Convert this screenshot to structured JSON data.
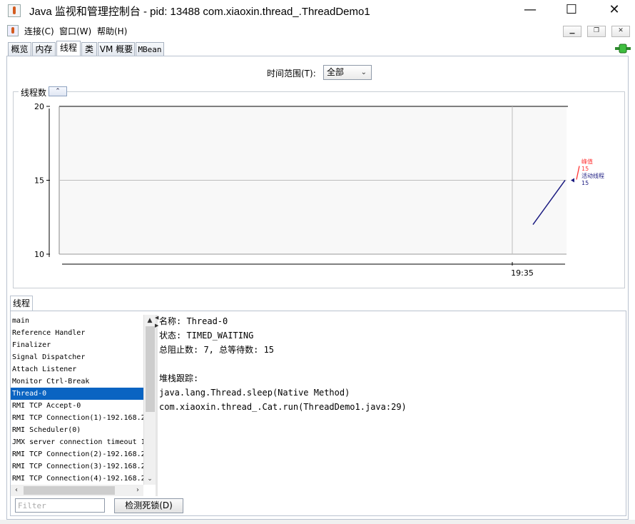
{
  "window": {
    "title": "Java 监视和管理控制台 - pid: 13488 com.xiaoxin.thread_.ThreadDemo1",
    "minimize_glyph": "—",
    "maximize_glyph": "☐",
    "close_glyph": "✕"
  },
  "menubar": {
    "items": [
      "连接(C)",
      "窗口(W)",
      "帮助(H)"
    ],
    "mdi_buttons": [
      "▁",
      "❐",
      "✕"
    ]
  },
  "tabs": [
    {
      "label": "概览",
      "active": false
    },
    {
      "label": "内存",
      "active": false
    },
    {
      "label": "线程",
      "active": true
    },
    {
      "label": "类",
      "active": false
    },
    {
      "label": "VM 概要",
      "active": false
    },
    {
      "label": "MBean",
      "active": false
    }
  ],
  "time_range": {
    "label": "时间范围(T):",
    "selected": "全部"
  },
  "chart_panel": {
    "title": "线程数",
    "collapse_glyph": "⌃",
    "legend": {
      "peak_label": "峰值",
      "peak_value": "15",
      "live_label": "活动线程",
      "live_value": "15"
    },
    "colors": {
      "peak": "#ff3333",
      "live": "#1a1a80"
    }
  },
  "chart_data": {
    "type": "line",
    "title": "",
    "xlabel": "",
    "ylabel": "",
    "ylim": [
      10,
      20
    ],
    "yticks": [
      10,
      15,
      20
    ],
    "xticks": [
      "19:35"
    ],
    "grid": true,
    "series": [
      {
        "name": "活动线程",
        "x": [
          "",
          ""
        ],
        "y": [
          12,
          15
        ]
      }
    ]
  },
  "thread_panel": {
    "tab_label": "线程",
    "threads": [
      "main",
      "Reference Handler",
      "Finalizer",
      "Signal Dispatcher",
      "Attach Listener",
      "Monitor Ctrl-Break",
      "Thread-0",
      "RMI TCP Accept-0",
      "RMI TCP Connection(1)-192.168.2",
      "RMI Scheduler(0)",
      "JMX server connection timeout 1",
      "RMI TCP Connection(2)-192.168.2",
      "RMI TCP Connection(3)-192.168.2",
      "RMI TCP Connection(4)-192.168.2"
    ],
    "selected_index": 6,
    "details": [
      "名称: Thread-0",
      "状态: TIMED_WAITING",
      "总阻止数: 7, 总等待数: 15",
      "",
      "堆栈跟踪:",
      "java.lang.Thread.sleep(Native Method)",
      "com.xiaoxin.thread_.Cat.run(ThreadDemo1.java:29)"
    ],
    "filter_placeholder": "Filter",
    "deadlock_button": "检测死锁(D)"
  }
}
